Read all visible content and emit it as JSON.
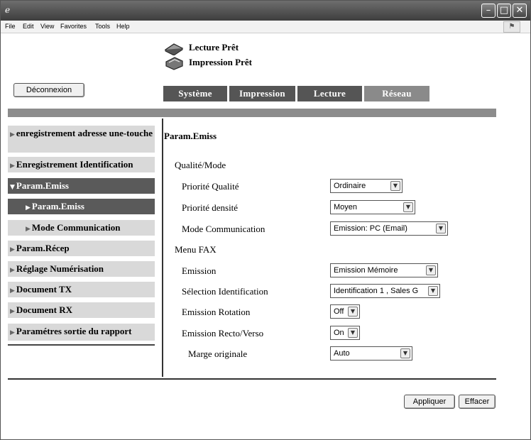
{
  "window": {
    "app_icon": "ie-icon",
    "minimize": "–",
    "maximize": "□",
    "close": "✕"
  },
  "menu": [
    "File",
    "Edit",
    "View",
    "Favorites",
    "Tools",
    "Help"
  ],
  "status": {
    "scan": "Lecture Prêt",
    "print": "Impression Prêt"
  },
  "logout_label": "Déconnexion",
  "tabs": [
    "Système",
    "Impression",
    "Lecture",
    "Réseau"
  ],
  "sidebar": [
    {
      "label": "enregistrement adresse une-touche",
      "state": "normal"
    },
    {
      "label": "Enregistrement Identification",
      "state": "normal"
    },
    {
      "label": "Param.Emiss",
      "state": "expanded"
    },
    {
      "label": "Param.Emiss",
      "state": "selected-sub"
    },
    {
      "label": "Mode Communication",
      "state": "sub"
    },
    {
      "label": "Param.Récep",
      "state": "normal"
    },
    {
      "label": "Réglage Numérisation",
      "state": "normal"
    },
    {
      "label": "Document TX",
      "state": "normal"
    },
    {
      "label": "Document RX",
      "state": "normal"
    },
    {
      "label": "Paramétres sortie du rapport",
      "state": "normal"
    }
  ],
  "main": {
    "title": "Param.Emiss",
    "section1": "Qualité/Mode",
    "section2": "Menu FAX",
    "fields": [
      {
        "label": "Priorité Qualité",
        "value": "Ordinaire"
      },
      {
        "label": "Priorité densité",
        "value": "Moyen"
      },
      {
        "label": "Mode Communication",
        "value": "Emission: PC (Email)"
      },
      {
        "label": "Emission",
        "value": "Emission Mémoire"
      },
      {
        "label": "Sélection Identification",
        "value": "Identification 1 , Sales G"
      },
      {
        "label": "Emission Rotation",
        "value": "Off"
      },
      {
        "label": "Emission Recto/Verso",
        "value": "On"
      },
      {
        "label": "Marge originale",
        "value": "Auto"
      }
    ]
  },
  "buttons": {
    "apply": "Appliquer",
    "clear": "Effacer"
  }
}
